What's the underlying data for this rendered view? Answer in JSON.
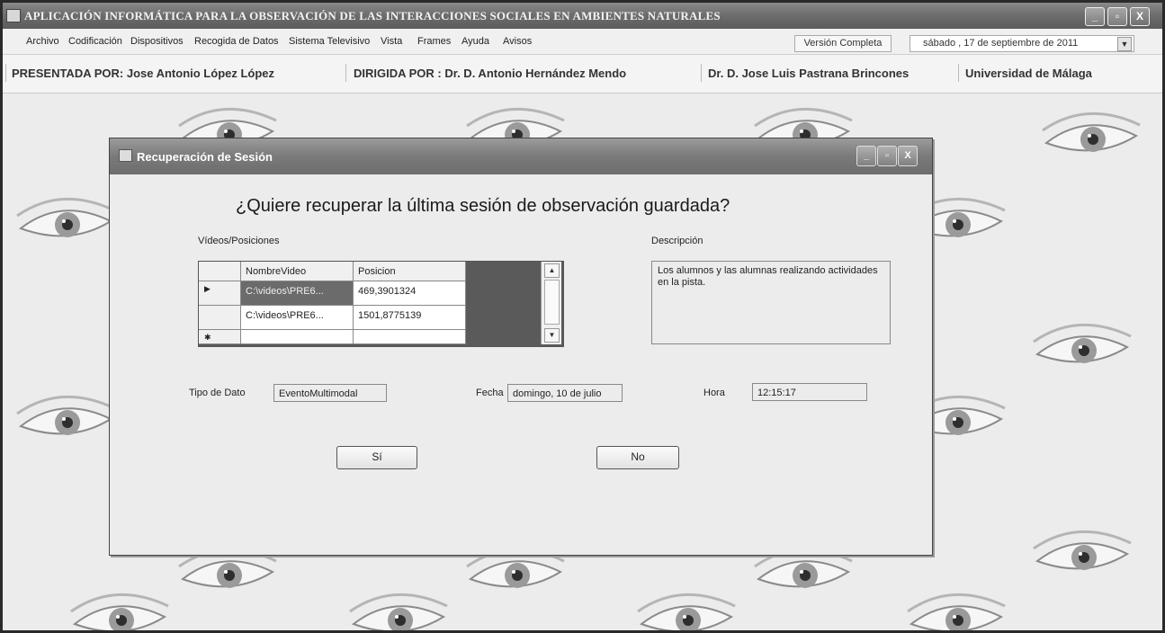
{
  "window": {
    "title": "APLICACIÓN INFORMÁTICA PARA LA OBSERVACIÓN DE LAS INTERACCIONES SOCIALES EN AMBIENTES NATURALES",
    "minimize": "_",
    "maximize": "▫",
    "close": "X"
  },
  "menu": {
    "items": [
      "Archivo",
      "Codificación",
      "Dispositivos",
      "Recogida de Datos",
      "Sistema Televisivo",
      "Vista",
      "Frames",
      "Ayuda",
      "Avisos"
    ],
    "version": "Versión Completa",
    "date": "sábado , 17 de septiembre de 2011",
    "date_arrow": "▼"
  },
  "credits": {
    "presented_by": "PRESENTADA POR: Jose Antonio López López",
    "directed_by": "DIRIGIDA POR : Dr. D. Antonio Hernández Mendo",
    "co_director": "Dr. D. Jose Luis Pastrana Brincones",
    "university": "Universidad de Málaga"
  },
  "dialog": {
    "title": "Recuperación de Sesión",
    "question": "¿Quiere recuperar la última sesión de observación guardada?",
    "videos_label": "Vídeos/Posiciones",
    "description_label": "Descripción",
    "grid": {
      "columns": [
        "NombreVideo",
        "Posicion"
      ],
      "rows": [
        {
          "marker": "▶",
          "name": "C:\\videos\\PRE6...",
          "position": "469,3901324"
        },
        {
          "marker": "",
          "name": "C:\\videos\\PRE6...",
          "position": "1501,8775139"
        },
        {
          "marker": "✱",
          "name": "",
          "position": ""
        }
      ],
      "scroll_up": "▲",
      "scroll_down": "▼"
    },
    "description": "Los alumnos y las alumnas realizando actividades en la pista.",
    "data_type_label": "Tipo de Dato",
    "data_type_value": "EventoMultimodal",
    "date_label": "Fecha",
    "date_value": "domingo, 10 de julio",
    "time_label": "Hora",
    "time_value": "12:15:17",
    "yes_button": "Sí",
    "no_button": "No"
  }
}
